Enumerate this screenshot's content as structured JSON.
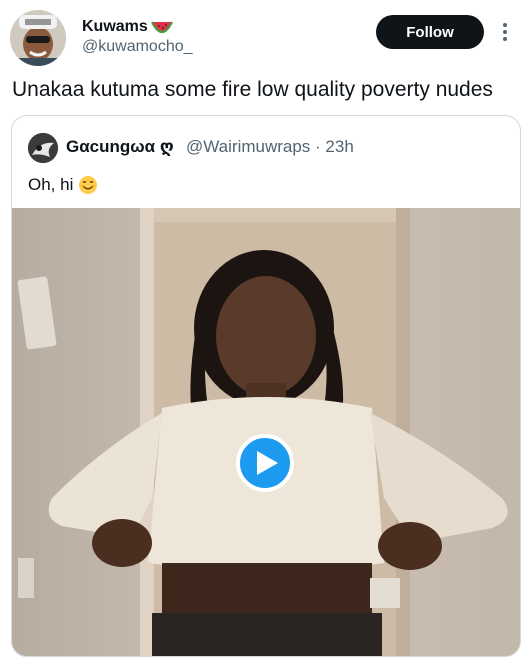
{
  "post": {
    "author_name": "Kuwams",
    "author_handle": "@kuwamocho_",
    "follow_label": "Follow",
    "text": "Unakaa kutuma some fire low quality poverty nudes"
  },
  "quoted": {
    "author_name": "Gαcungωα ღ",
    "meta": "@Wairimuwraps · 23h",
    "text": "Oh, hi",
    "media_type": "video"
  },
  "colors": {
    "follow_bg": "#0f1419",
    "play_button": "#1d9bf0",
    "secondary_text": "#536471",
    "border": "#cfd9de"
  },
  "icons": {
    "author_badge": "watermelon-icon",
    "more": "more-vertical-icon",
    "emoji": "smiling-face-icon",
    "media": "play-icon"
  }
}
